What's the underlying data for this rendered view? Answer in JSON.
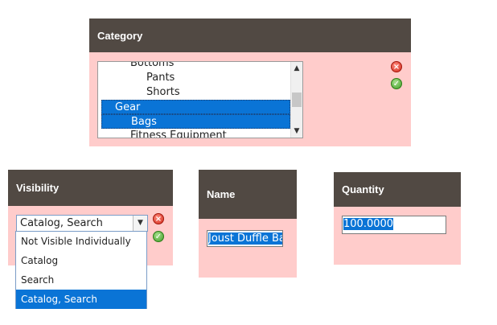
{
  "category": {
    "header": "Category",
    "options": [
      {
        "label": "Bottoms",
        "indent": 2,
        "selected": false
      },
      {
        "label": "Pants",
        "indent": 3,
        "selected": false
      },
      {
        "label": "Shorts",
        "indent": 3,
        "selected": false
      },
      {
        "label": "Gear",
        "indent": 1,
        "selected": true
      },
      {
        "label": "Bags",
        "indent": 2,
        "selected": true
      },
      {
        "label": "Fitness Equipment",
        "indent": 2,
        "selected": false
      }
    ]
  },
  "visibility": {
    "header": "Visibility",
    "selected_value": "Catalog, Search",
    "options": [
      {
        "label": "Not Visible Individually",
        "selected": false
      },
      {
        "label": "Catalog",
        "selected": false
      },
      {
        "label": "Search",
        "selected": false
      },
      {
        "label": "Catalog, Search",
        "selected": true
      }
    ]
  },
  "name": {
    "header": "Name",
    "value": "Joust Duffle Ba"
  },
  "quantity": {
    "header": "Quantity",
    "value": "100.0000"
  },
  "icons": {
    "cancel": "cancel-icon",
    "apply": "apply-icon"
  },
  "colors": {
    "panel_background": "#ffcccb",
    "header_background": "#514943",
    "selection": "#0a74d6"
  }
}
